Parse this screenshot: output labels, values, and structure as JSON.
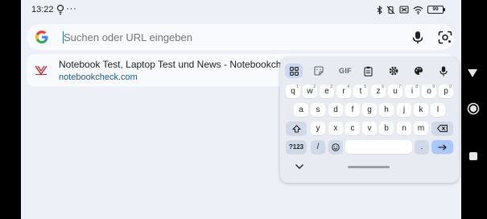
{
  "status_bar": {
    "time": "13:22",
    "more_indicator": "···",
    "battery": "99",
    "left_icons": [
      "lightbulb-icon"
    ],
    "right_icons": [
      "bluetooth-icon",
      "vibrate-off-icon",
      "no-sim-icon",
      "wifi-icon",
      "battery-icon"
    ]
  },
  "search": {
    "placeholder": "Suchen oder URL eingeben",
    "value": "",
    "left_icon": "google-logo",
    "right_icons": [
      "mic-icon",
      "google-lens-icon"
    ]
  },
  "suggestion": {
    "title": "Notebook Test, Laptop Test und News - Notebookcheck.com",
    "url": "notebookcheck.com",
    "icon": "notebookcheck-favicon"
  },
  "keyboard": {
    "toolbar": {
      "items": [
        "apps-grid-icon",
        "sticker-icon",
        "gif-button",
        "clipboard-icon",
        "settings-icon",
        "palette-icon",
        "mic-icon"
      ],
      "gif_label": "GIF"
    },
    "row1": [
      {
        "label": "q",
        "sup": "1"
      },
      {
        "label": "w",
        "sup": "2"
      },
      {
        "label": "e",
        "sup": "3"
      },
      {
        "label": "r",
        "sup": "4"
      },
      {
        "label": "t",
        "sup": "5"
      },
      {
        "label": "z",
        "sup": "6"
      },
      {
        "label": "u",
        "sup": "7"
      },
      {
        "label": "i",
        "sup": "8"
      },
      {
        "label": "o",
        "sup": "9"
      },
      {
        "label": "p",
        "sup": "0"
      }
    ],
    "row2": [
      "a",
      "s",
      "d",
      "f",
      "g",
      "h",
      "j",
      "k",
      "l"
    ],
    "row3": [
      "y",
      "x",
      "c",
      "v",
      "b",
      "n",
      "m"
    ],
    "row4": {
      "symbols": "?123",
      "slash": "/",
      "emoji": "emoji-icon",
      "space": "",
      "period": ".",
      "enter": "enter-arrow-icon"
    }
  },
  "navigation": [
    "back-icon",
    "home-icon",
    "recents-icon"
  ],
  "colors": {
    "background": "#edf0f6",
    "surface": "#f9fafd",
    "accent": "#a8c7fa",
    "link": "#1a5c8a"
  }
}
